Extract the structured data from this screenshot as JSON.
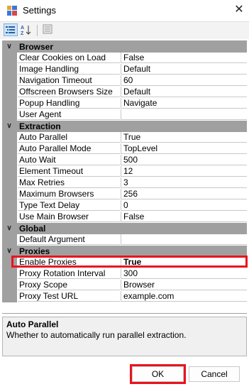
{
  "window": {
    "title": "Settings",
    "close_symbol": "✕",
    "icon": "settings-app-icon"
  },
  "toolbar": {
    "categorized_icon": "categorized-view-icon",
    "alphabetical_icon": "alphabetical-sort-icon",
    "property_pages_icon": "property-pages-icon"
  },
  "categories": [
    {
      "name": "Browser",
      "expanded": true,
      "properties": [
        {
          "name": "Clear Cookies on Load",
          "value": "False"
        },
        {
          "name": "Image Handling",
          "value": "Default"
        },
        {
          "name": "Navigation Timeout",
          "value": "60"
        },
        {
          "name": "Offscreen Browsers Size",
          "value": "Default"
        },
        {
          "name": "Popup Handling",
          "value": "Navigate"
        },
        {
          "name": "User Agent",
          "value": ""
        }
      ]
    },
    {
      "name": "Extraction",
      "expanded": true,
      "properties": [
        {
          "name": "Auto Parallel",
          "value": "True"
        },
        {
          "name": "Auto Parallel Mode",
          "value": "TopLevel"
        },
        {
          "name": "Auto Wait",
          "value": "500"
        },
        {
          "name": "Element Timeout",
          "value": "12"
        },
        {
          "name": "Max Retries",
          "value": "3"
        },
        {
          "name": "Maximum Browsers",
          "value": "256"
        },
        {
          "name": "Type Text Delay",
          "value": "0"
        },
        {
          "name": "Use Main Browser",
          "value": "False"
        }
      ]
    },
    {
      "name": "Global",
      "expanded": true,
      "properties": [
        {
          "name": "Default Argument",
          "value": ""
        }
      ]
    },
    {
      "name": "Proxies",
      "expanded": true,
      "properties": [
        {
          "name": "Enable Proxies",
          "value": "True"
        },
        {
          "name": "Proxy Rotation Interval",
          "value": "300"
        },
        {
          "name": "Proxy Scope",
          "value": "Browser"
        },
        {
          "name": "Proxy Test URL",
          "value": "example.com"
        }
      ]
    }
  ],
  "selected_property": "Enable Proxies",
  "description": {
    "title": "Auto Parallel",
    "text": "Whether to automatically run parallel extraction."
  },
  "buttons": {
    "ok": "OK",
    "cancel": "Cancel"
  },
  "colors": {
    "highlight_red": "#e8141f",
    "category_bg": "#a0a0a0"
  }
}
